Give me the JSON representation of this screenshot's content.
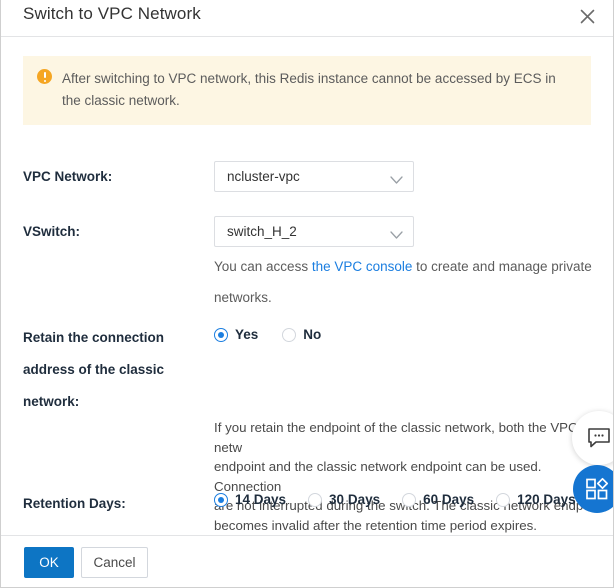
{
  "dialog": {
    "title": "Switch to VPC Network",
    "close_icon": "close-icon"
  },
  "warning": {
    "icon": "warning-exclamation-icon",
    "text": "After switching to VPC network, this Redis instance cannot be accessed by ECS in the classic network."
  },
  "form": {
    "vpc_network": {
      "label": "VPC Network:",
      "value": "ncluster-vpc",
      "arrow_icon": "chevron-down-icon"
    },
    "vswitch": {
      "label": "VSwitch:",
      "value": "switch_H_2",
      "arrow_icon": "chevron-down-icon"
    },
    "vswitch_helper": {
      "prefix": "You can access ",
      "link": "the VPC console",
      "suffix": " to create and manage private networks."
    },
    "retain_connection": {
      "label": "Retain the connection address of the classic network:",
      "options": [
        {
          "label": "Yes",
          "checked": true
        },
        {
          "label": "No",
          "checked": false
        }
      ]
    },
    "retain_description": "If you retain the endpoint of the classic network, both the VPC netw\nendpoint and the classic network endpoint can be used. Connection\nare not interrupted during the switch. The classic network endpoint\nbecomes invalid after the retention time period expires.",
    "retention_days": {
      "label": "Retention Days:",
      "options": [
        {
          "label": "14 Days",
          "checked": true
        },
        {
          "label": "30 Days",
          "checked": false
        },
        {
          "label": "60 Days",
          "checked": false
        },
        {
          "label": "120 Days",
          "checked": false
        }
      ]
    }
  },
  "floating": {
    "chat_icon": "chat-bubble-icon",
    "apps_icon": "apps-grid-icon"
  },
  "footer": {
    "ok_label": "OK",
    "cancel_label": "Cancel"
  },
  "colors": {
    "accent": "#1b7ee0",
    "primary_button": "#0d75c4",
    "warning_bg": "#fdf6e3",
    "warning_icon": "#f5a623",
    "link": "#1b7ee0"
  }
}
